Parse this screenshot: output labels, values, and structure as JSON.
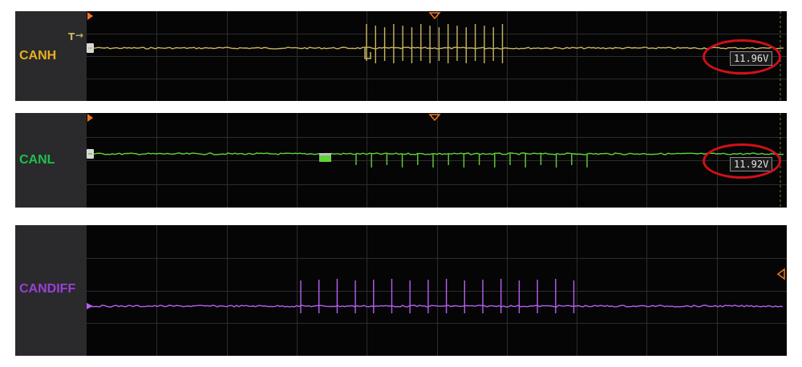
{
  "channels": [
    {
      "key": "canh",
      "label": "CANH",
      "color": "#e8b020",
      "trace_color": "#c8b560",
      "readout": "11.96V",
      "trigger_label": "T"
    },
    {
      "key": "canl",
      "label": "CANL",
      "color": "#1fbf4f",
      "trace_color": "#5fd33a",
      "readout": "11.92V"
    },
    {
      "key": "candiff",
      "label": "CANDIFF",
      "color": "#9b3fd6",
      "trace_color": "#b65ef0"
    }
  ],
  "colors": {
    "marker_orange": "#f07820",
    "highlight_ring": "#d0101a"
  },
  "icons": {
    "ground_marker": "ground-reference-marker-icon",
    "trigger_time": "trigger-time-marker-icon",
    "trigger_level": "trigger-level-marker-icon"
  }
}
